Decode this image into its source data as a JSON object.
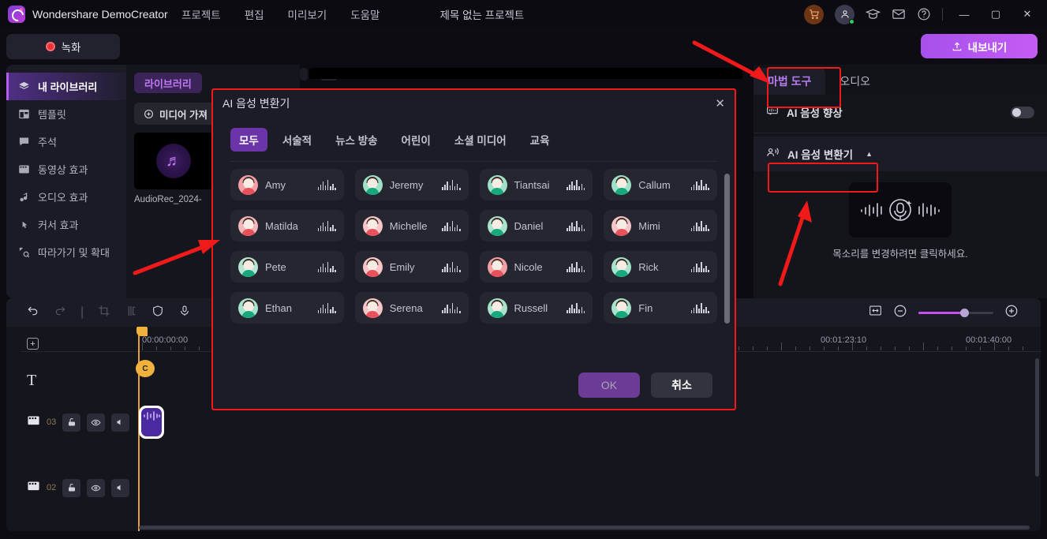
{
  "app": {
    "brand": "Wondershare DemoCreator",
    "project_title": "제목 없는 프로젝트",
    "menu": [
      "프로젝트",
      "편집",
      "미리보기",
      "도움말"
    ],
    "titlebar_icons": [
      "cart-icon",
      "account-icon",
      "academy-icon",
      "mail-icon",
      "help-icon",
      "minimize-icon",
      "maximize-icon",
      "close-icon"
    ],
    "record_label": "녹화",
    "export_label": "내보내기"
  },
  "sidebar": {
    "items": [
      {
        "label": "내 라이브러리",
        "icon": "layers-icon",
        "active": true
      },
      {
        "label": "템플릿",
        "icon": "template-icon",
        "active": false
      },
      {
        "label": "주석",
        "icon": "comment-icon",
        "active": false
      },
      {
        "label": "동영상 효과",
        "icon": "film-icon",
        "active": false
      },
      {
        "label": "오디오 효과",
        "icon": "audio-note-icon",
        "active": false
      },
      {
        "label": "커서 효과",
        "icon": "cursor-sparkle-icon",
        "active": false
      },
      {
        "label": "따라가기 및 확대",
        "icon": "zoom-pan-icon",
        "active": false
      }
    ]
  },
  "library": {
    "chip_label": "라이브러리",
    "import_label": "미디어 가져",
    "media": [
      {
        "name": "AudioRec_2024-",
        "icon": "music-disc-icon"
      }
    ]
  },
  "right_panel": {
    "tabs": [
      {
        "label": "마법 도구",
        "active": true
      },
      {
        "label": "오디오",
        "active": false
      }
    ],
    "voice_enhance": {
      "label": "AI 음성 향상",
      "icon": "speech-icon",
      "toggle_on": false
    },
    "voice_changer": {
      "label": "AI 음성 변환기",
      "icon": "voice-changer-icon",
      "caret": "▲",
      "hint": "목소리를 변경하려면 클릭하세요."
    }
  },
  "modal": {
    "title": "AI 음성 변환기",
    "close_icon": "close-icon",
    "tabs": [
      {
        "label": "모두",
        "active": true
      },
      {
        "label": "서술적",
        "active": false
      },
      {
        "label": "뉴스 방송",
        "active": false
      },
      {
        "label": "어린이",
        "active": false
      },
      {
        "label": "소셜 미디어",
        "active": false
      },
      {
        "label": "교육",
        "active": false
      }
    ],
    "voices": [
      {
        "name": "Amy",
        "gender": "f",
        "color": "#f2a0a6"
      },
      {
        "name": "Jeremy",
        "gender": "m",
        "color": "#9fe0c8"
      },
      {
        "name": "Tiantsai",
        "gender": "m",
        "color": "#9fe0c8"
      },
      {
        "name": "Callum",
        "gender": "m",
        "color": "#9fe0c8"
      },
      {
        "name": "Matilda",
        "gender": "f",
        "color": "#f2b6bb"
      },
      {
        "name": "Michelle",
        "gender": "f",
        "color": "#f7c6c9"
      },
      {
        "name": "Daniel",
        "gender": "m",
        "color": "#a8e3cd"
      },
      {
        "name": "Mimi",
        "gender": "f",
        "color": "#f7c6c9"
      },
      {
        "name": "Pete",
        "gender": "m",
        "color": "#b5e6d4"
      },
      {
        "name": "Emily",
        "gender": "f",
        "color": "#f7c6c9"
      },
      {
        "name": "Nicole",
        "gender": "f",
        "color": "#f2a0a6"
      },
      {
        "name": "Rick",
        "gender": "m",
        "color": "#a8e3cd"
      },
      {
        "name": "Ethan",
        "gender": "m",
        "color": "#a8e3cd"
      },
      {
        "name": "Serena",
        "gender": "f",
        "color": "#f7c6c9"
      },
      {
        "name": "Russell",
        "gender": "m",
        "color": "#a8e3cd"
      },
      {
        "name": "Fin",
        "gender": "m",
        "color": "#a8e3cd"
      }
    ],
    "ok_label": "OK",
    "cancel_label": "취소"
  },
  "timeline": {
    "tools": [
      "undo-icon",
      "redo-icon",
      "crop-icon",
      "split-icon",
      "shield-icon",
      "mic-icon"
    ],
    "zoom_icons": [
      "fit-icon",
      "zoom-out-icon",
      "zoom-in-icon"
    ],
    "zoom_value": 60,
    "start_timecode": "00:00:00:00",
    "timecodes": [
      "00:01:23:10",
      "00:01:40:00"
    ],
    "playhead_badge": "C",
    "tracks": [
      {
        "type": "text",
        "icon": "text-icon",
        "number": ""
      },
      {
        "type": "video",
        "icon": "film-icon",
        "number": "03"
      },
      {
        "type": "video",
        "icon": "film-icon",
        "number": "02"
      }
    ],
    "track_buttons": [
      "lock-icon",
      "eye-icon",
      "mute-icon"
    ]
  },
  "colors": {
    "accent": "#b45cf0",
    "annotation": "#f01a1a",
    "playhead": "#e8a13a",
    "export": "#c45cf5"
  }
}
